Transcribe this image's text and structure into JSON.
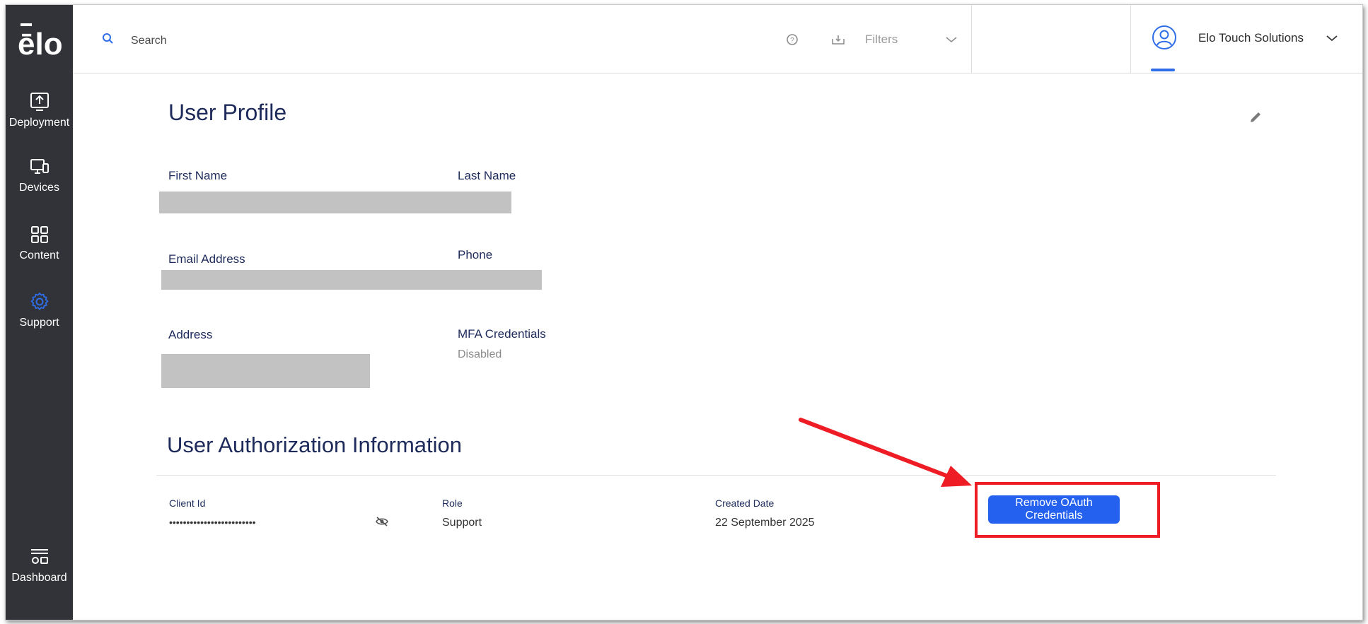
{
  "sidebar": {
    "logo_text": "ēlo",
    "items": [
      {
        "label": "Deployment",
        "icon": "upload-monitor-icon"
      },
      {
        "label": "Devices",
        "icon": "devices-icon"
      },
      {
        "label": "Content",
        "icon": "grid-icon"
      },
      {
        "label": "Support",
        "icon": "gear-icon"
      },
      {
        "label": "Dashboard",
        "icon": "dashboard-icon"
      }
    ],
    "active": "Support"
  },
  "topbar": {
    "search_placeholder": "Search",
    "filters_label": "Filters",
    "user_name": "Elo Touch Solutions"
  },
  "profile": {
    "title": "User Profile",
    "first_name_label": "First Name",
    "last_name_label": "Last Name",
    "email_label": "Email Address",
    "phone_label": "Phone",
    "address_label": "Address",
    "mfa_label": "MFA Credentials",
    "mfa_value": "Disabled"
  },
  "auth": {
    "title": "User Authorization Information",
    "client_id_label": "Client Id",
    "client_id_value": "•••••••••••••••••••••••••",
    "role_label": "Role",
    "role_value": "Support",
    "created_label": "Created Date",
    "created_value": "22 September 2025",
    "remove_button": "Remove OAuth Credentials"
  },
  "colors": {
    "sidebar_bg": "#323338",
    "accent": "#2f6ee8",
    "button": "#2461ee",
    "heading": "#1d2a5a",
    "annotation": "#ee1c24"
  }
}
